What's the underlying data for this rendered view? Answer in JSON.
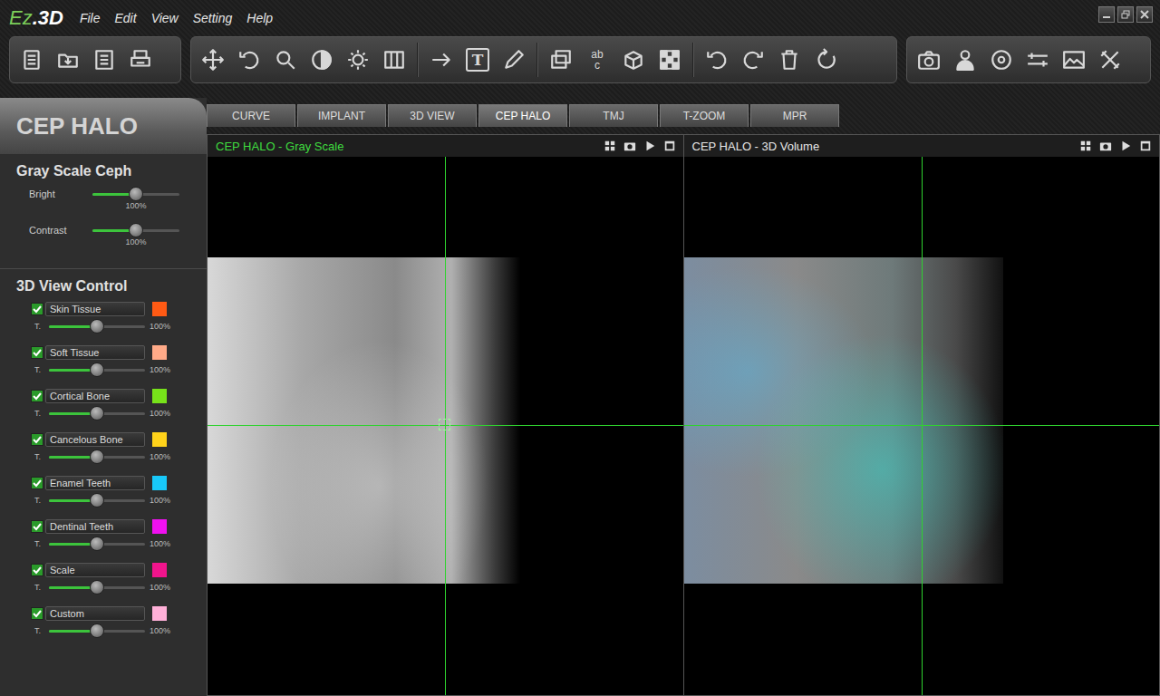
{
  "app": {
    "logo_main": "Ez",
    "logo_suffix": ".3D"
  },
  "menu": [
    {
      "label": "File"
    },
    {
      "label": "Edit"
    },
    {
      "label": "View"
    },
    {
      "label": "Setting"
    },
    {
      "label": "Help"
    }
  ],
  "toolbar_glyphs": {
    "text_tool": "T",
    "label_tool_top": "ab",
    "label_tool_bottom": "c"
  },
  "module_title": "CEP HALO",
  "tabs": [
    {
      "label": "CURVE",
      "selected": false
    },
    {
      "label": "IMPLANT",
      "selected": false
    },
    {
      "label": "3D VIEW",
      "selected": false
    },
    {
      "label": "CEP HALO",
      "selected": true
    },
    {
      "label": "TMJ",
      "selected": false
    },
    {
      "label": "T-ZOOM",
      "selected": false
    },
    {
      "label": "MPR",
      "selected": false
    }
  ],
  "gray_scale": {
    "title": "Gray Scale Ceph",
    "sliders": [
      {
        "label": "Bright",
        "level": 0.5,
        "reading": "100%"
      },
      {
        "label": "Contrast",
        "level": 0.5,
        "reading": "100%"
      }
    ]
  },
  "view_control": {
    "title": "3D View Control",
    "slider_label": "T.",
    "layers": [
      {
        "name": "Skin Tissue",
        "checked": true,
        "color": "#ff5a14",
        "level": 0.5,
        "reading": "100%"
      },
      {
        "name": "Soft Tissue",
        "checked": true,
        "color": "#ffaa88",
        "level": 0.5,
        "reading": "100%"
      },
      {
        "name": "Cortical Bone",
        "checked": true,
        "color": "#77e21a",
        "level": 0.5,
        "reading": "100%"
      },
      {
        "name": "Cancelous Bone",
        "checked": true,
        "color": "#ffd21a",
        "level": 0.5,
        "reading": "100%"
      },
      {
        "name": "Enamel Teeth",
        "checked": true,
        "color": "#18c8f8",
        "level": 0.5,
        "reading": "100%"
      },
      {
        "name": "Dentinal Teeth",
        "checked": true,
        "color": "#f010f0",
        "level": 0.5,
        "reading": "100%"
      },
      {
        "name": "Scale",
        "checked": true,
        "color": "#f0148c",
        "level": 0.5,
        "reading": "100%"
      },
      {
        "name": "Custom",
        "checked": true,
        "color": "#ffb0d8",
        "level": 0.5,
        "reading": "100%"
      }
    ]
  },
  "viewports": [
    {
      "title": "CEP HALO - Gray Scale",
      "active": true,
      "kind": "gray"
    },
    {
      "title": "CEP HALO - 3D Volume",
      "active": false,
      "kind": "volume"
    }
  ]
}
